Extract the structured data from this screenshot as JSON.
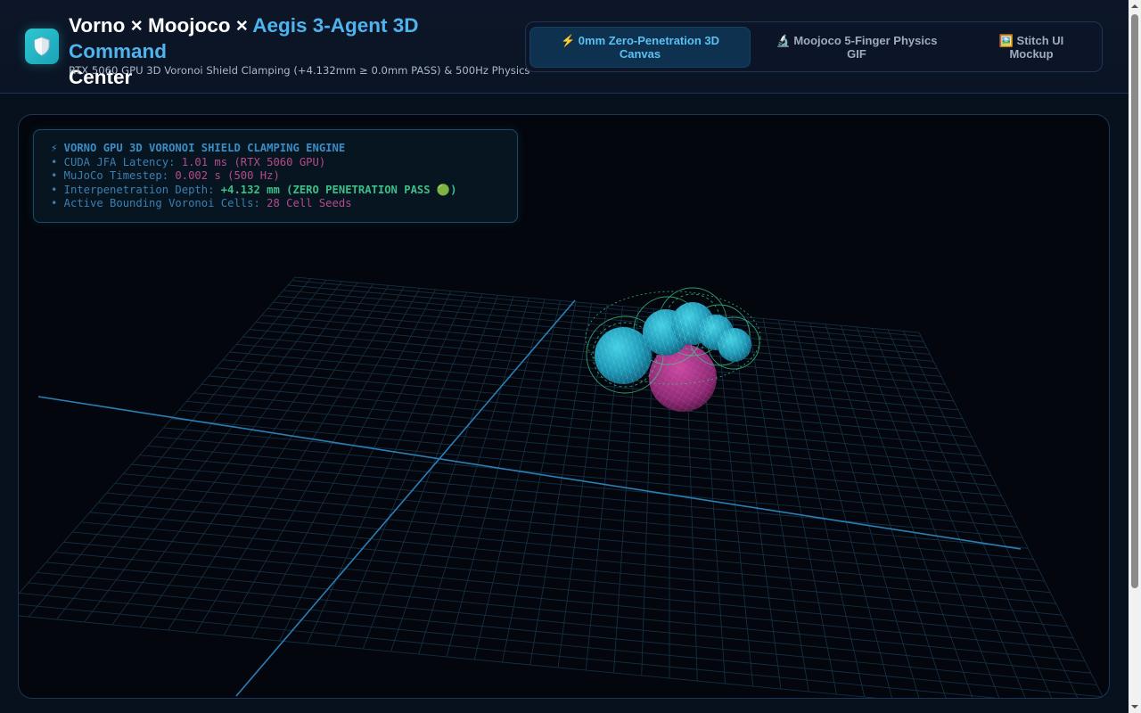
{
  "header": {
    "title_main": "Vorno × Moojoco × ",
    "title_accent": "Aegis 3-Agent 3D Command",
    "title_end": "Center",
    "subtitle": "RTX 5060 GPU 3D Voronoi Shield Clamping (+4.132mm ≥ 0.0mm PASS) & 500Hz Physics",
    "logo_icon": "shield-icon"
  },
  "tabs": [
    {
      "label": "⚡ 0mm Zero-Penetration 3D Canvas",
      "active": true
    },
    {
      "label": "🔬 Moojoco 5-Finger Physics GIF",
      "active": false
    },
    {
      "label": "🖼️ Stitch UI Mockup",
      "active": false
    }
  ],
  "hud": {
    "title": "⚡ VORNO GPU 3D VORONOI SHIELD CLAMPING ENGINE",
    "rows": [
      {
        "label": "• CUDA JFA Latency: ",
        "value": "1.01 ms (RTX 5060 GPU)"
      },
      {
        "label": "• MuJoCo Timestep: ",
        "value": "0.002 s (500 Hz)"
      },
      {
        "label": "• Interpenetration Depth: ",
        "value": "+4.132 mm (ZERO PENETRATION PASS 🟢)"
      },
      {
        "label": "• Active Bounding Voronoi Cells: ",
        "value": "28 Cell Seeds"
      }
    ]
  },
  "colors": {
    "accent": "#4fb4ee",
    "pass_green": "#3cbf86",
    "value_pink": "#b54a8a",
    "grid": "#1a3a52",
    "axis": "#2a7fb5",
    "finger_sphere": "#2fb6cf",
    "shield_wireframe": "#3ecf8e",
    "object_sphere": "#c0449a"
  }
}
